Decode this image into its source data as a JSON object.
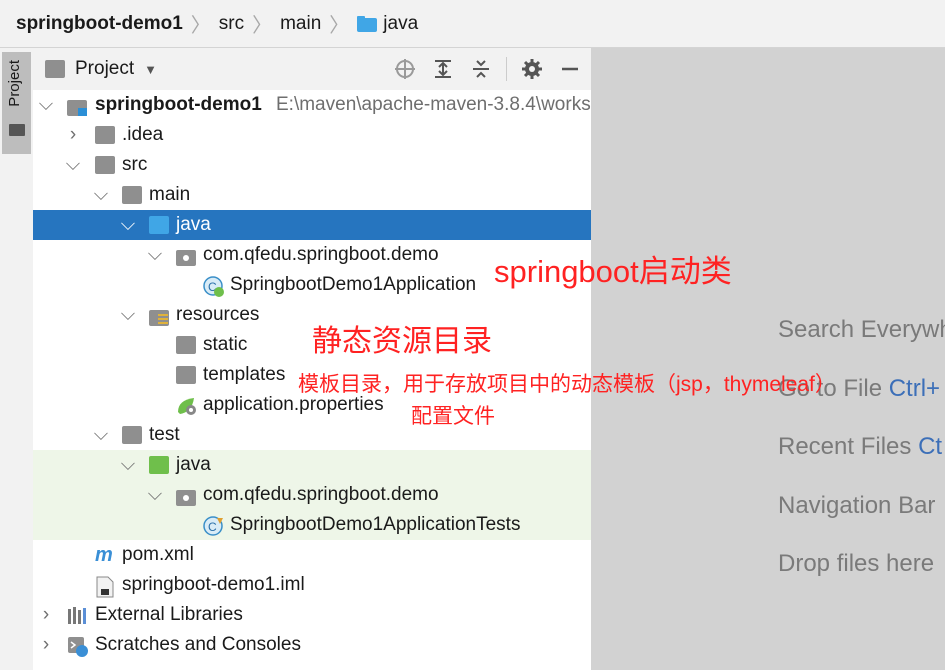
{
  "breadcrumb": {
    "items": [
      "springboot-demo1",
      "src",
      "main",
      "java"
    ]
  },
  "side_tab": {
    "label": "Project"
  },
  "panel": {
    "title": "Project"
  },
  "tree": {
    "root_name": "springboot-demo1",
    "root_path": "E:\\maven\\apache-maven-3.8.4\\works",
    "idea": ".idea",
    "src": "src",
    "main": "main",
    "java": "java",
    "package": "com.qfedu.springboot.demo",
    "app_class": "SpringbootDemo1Application",
    "resources": "resources",
    "static": "static",
    "templates": "templates",
    "app_props": "application.properties",
    "test": "test",
    "test_java": "java",
    "test_package": "com.qfedu.springboot.demo",
    "test_class": "SpringbootDemo1ApplicationTests",
    "pom": "pom.xml",
    "iml": "springboot-demo1.iml",
    "ext_libs": "External Libraries",
    "scratches": "Scratches and Consoles"
  },
  "annotations": {
    "startup_class": "springboot启动类",
    "static_resources": "静态资源目录",
    "templates": "模板目录，用于存放项目中的动态模板（jsp，thymeleaf）",
    "config_file": "配置文件"
  },
  "hints": {
    "search": "Search Everywh",
    "goto_file": "Go to File ",
    "goto_file_key": "Ctrl+",
    "recent_files": "Recent Files ",
    "recent_files_key": "Ct",
    "nav_bar": "Navigation Bar",
    "drop": "Drop files here"
  },
  "colors": {
    "selection": "#2675bf",
    "annotation": "#ff2222",
    "test_background": "#eef6e8",
    "shortcut": "#3c6fb8"
  }
}
